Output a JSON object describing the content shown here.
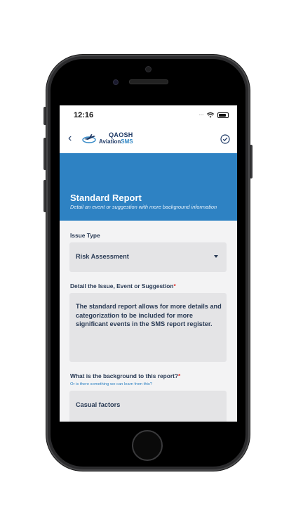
{
  "status": {
    "time": "12:16"
  },
  "app": {
    "logo_line1": "QAOSH",
    "logo_line2_a": "Aviation",
    "logo_line2_b": "SMS"
  },
  "header": {
    "title": "Standard Report",
    "subtitle": "Detail an event or suggestion with more background information"
  },
  "form": {
    "issue_type": {
      "label": "Issue Type",
      "value": "Risk Assessment"
    },
    "detail": {
      "label": "Detail the Issue, Event or Suggestion",
      "required_mark": "*",
      "value": "The standard report allows for more details and categorization to be included for more significant events in the SMS report register."
    },
    "background": {
      "label": "What is the background to this report?",
      "required_mark": "*",
      "hint": "Or is there something we can learn from this?",
      "value": "Casual factors"
    }
  },
  "colors": {
    "primary": "#2e82c3",
    "navy": "#1f3a66",
    "required": "#e0342f"
  },
  "icons": {
    "back": "chevron-left-icon",
    "confirm": "check-circle-icon",
    "dropdown": "caret-down-icon"
  }
}
